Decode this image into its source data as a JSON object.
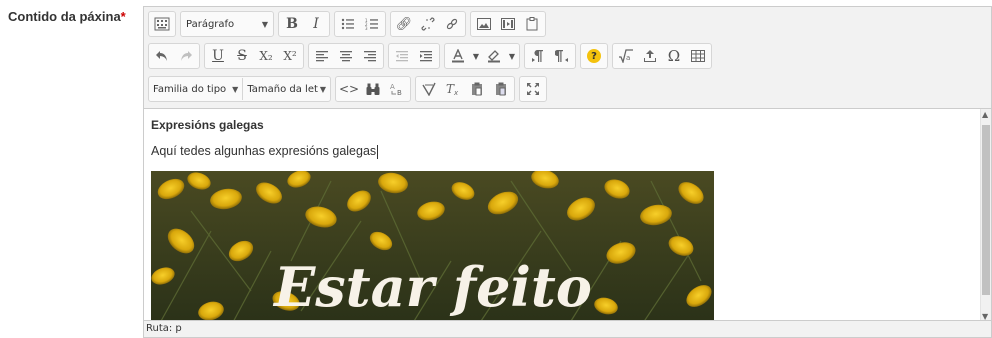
{
  "field": {
    "label": "Contido da páxina",
    "required_mark": "*"
  },
  "toolbar": {
    "row1": {
      "paragraph_format": "Parágrafo",
      "bold": "B",
      "italic": "I"
    },
    "row2": {
      "underline": "U",
      "strikethrough": "S",
      "subscript": "X₂",
      "superscript": "X²",
      "help_badge": "?",
      "omega": "Ω"
    },
    "row3": {
      "font_family": "Familia do tipo",
      "font_size": "Tamaño da let"
    }
  },
  "content": {
    "heading": "Expresións galegas",
    "paragraph": "Aquí tedes algunhas expresións galegas",
    "image_text": "Estar feito"
  },
  "statusbar": {
    "path": "Ruta: p"
  },
  "colors": {
    "help_yellow": "#f4c20d",
    "flower_yellow": "#e9b711",
    "gorse_green": "#3c4a22"
  }
}
